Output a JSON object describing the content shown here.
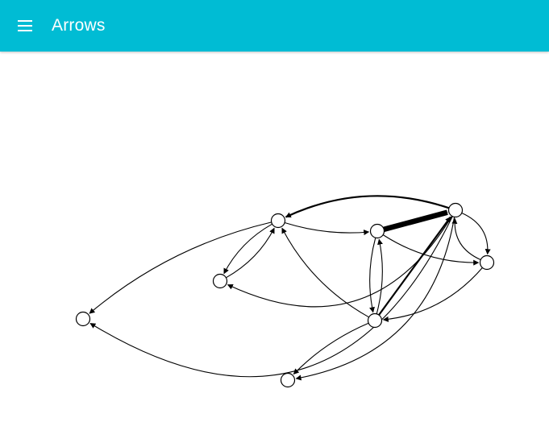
{
  "app": {
    "title": "Arrows",
    "accent_color": "#00bcd4",
    "menu_icon": "hamburger-menu-icon"
  },
  "graph": {
    "nodes": [
      {
        "id": "A"
      },
      {
        "id": "B"
      },
      {
        "id": "C"
      },
      {
        "id": "D"
      },
      {
        "id": "E"
      },
      {
        "id": "F"
      },
      {
        "id": "G"
      },
      {
        "id": "H"
      }
    ],
    "edges": [
      {
        "from": "E",
        "to": "A",
        "weight": 1
      },
      {
        "from": "E",
        "to": "B",
        "weight": 1
      },
      {
        "from": "E",
        "to": "C",
        "weight": 2
      },
      {
        "from": "D",
        "to": "E",
        "weight": 6
      },
      {
        "from": "G",
        "to": "E",
        "weight": 2
      },
      {
        "from": "E",
        "to": "F",
        "weight": 1
      },
      {
        "from": "F",
        "to": "E",
        "weight": 1
      },
      {
        "from": "E",
        "to": "H",
        "weight": 1
      },
      {
        "from": "C",
        "to": "A",
        "weight": 1
      },
      {
        "from": "B",
        "to": "C",
        "weight": 1
      },
      {
        "from": "C",
        "to": "B",
        "weight": 1
      },
      {
        "from": "C",
        "to": "D",
        "weight": 1
      },
      {
        "from": "G",
        "to": "C",
        "weight": 1
      },
      {
        "from": "D",
        "to": "F",
        "weight": 1
      },
      {
        "from": "D",
        "to": "G",
        "weight": 1
      },
      {
        "from": "G",
        "to": "D",
        "weight": 1
      },
      {
        "from": "F",
        "to": "G",
        "weight": 1
      },
      {
        "from": "G",
        "to": "H",
        "weight": 1
      }
    ]
  }
}
